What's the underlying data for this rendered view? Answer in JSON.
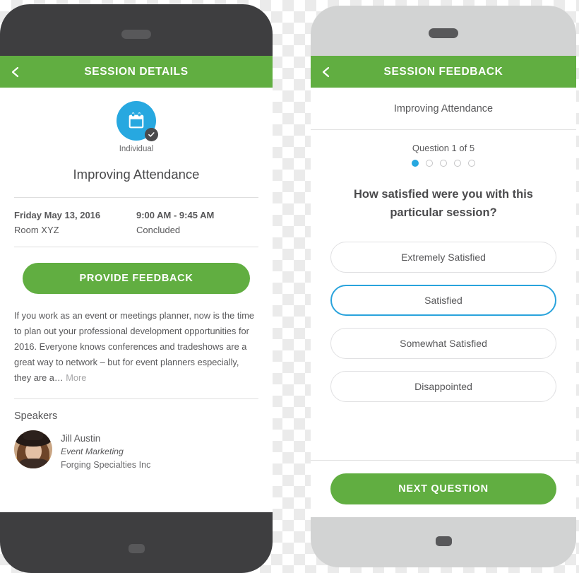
{
  "left_phone": {
    "appbar": {
      "title": "SESSION DETAILS",
      "back_icon": "chevron-left-icon"
    },
    "session_type": {
      "icon": "calendar-icon",
      "badge_icon": "check-circle-icon",
      "label": "Individual"
    },
    "session_title": "Improving Attendance",
    "meta": {
      "date": "Friday May 13, 2016",
      "time": "9:00 AM - 9:45 AM",
      "room": "Room XYZ",
      "status": "Concluded"
    },
    "cta_label": "PROVIDE FEEDBACK",
    "description": "If you work as an event or meetings planner, now is the time to plan out your professional development opportunities for 2016. Everyone knows conferences and tradeshows are a great way to network – but for event planners especially, they are a… ",
    "more_label": "More",
    "speakers_heading": "Speakers",
    "speakers": [
      {
        "name": "Jill Austin",
        "role": "Event Marketing",
        "organization": "Forging Specialties Inc",
        "avatar": "speaker-photo"
      }
    ]
  },
  "right_phone": {
    "appbar": {
      "title": "SESSION FEEDBACK",
      "back_icon": "chevron-left-icon"
    },
    "session_name": "Improving Attendance",
    "question_counter": "Question 1 of 5",
    "total_questions": 5,
    "active_question_index": 0,
    "question_text": "How satisfied were you with this particular session?",
    "options": [
      {
        "label": "Extremely Satisfied",
        "selected": false
      },
      {
        "label": "Satisfied",
        "selected": true
      },
      {
        "label": "Somewhat Satisfied",
        "selected": false
      },
      {
        "label": "Disappointed",
        "selected": false
      }
    ],
    "next_label": "NEXT QUESTION"
  },
  "colors": {
    "brand_green": "#61ae41",
    "accent_blue": "#27a8e0",
    "selected_border": "#29a3dc",
    "text_dark": "#4a4a4c",
    "text_gray": "#58585a",
    "muted_gray": "#a6a6a8",
    "left_bezel": "#3e3e40",
    "right_bezel": "#d2d3d3"
  }
}
